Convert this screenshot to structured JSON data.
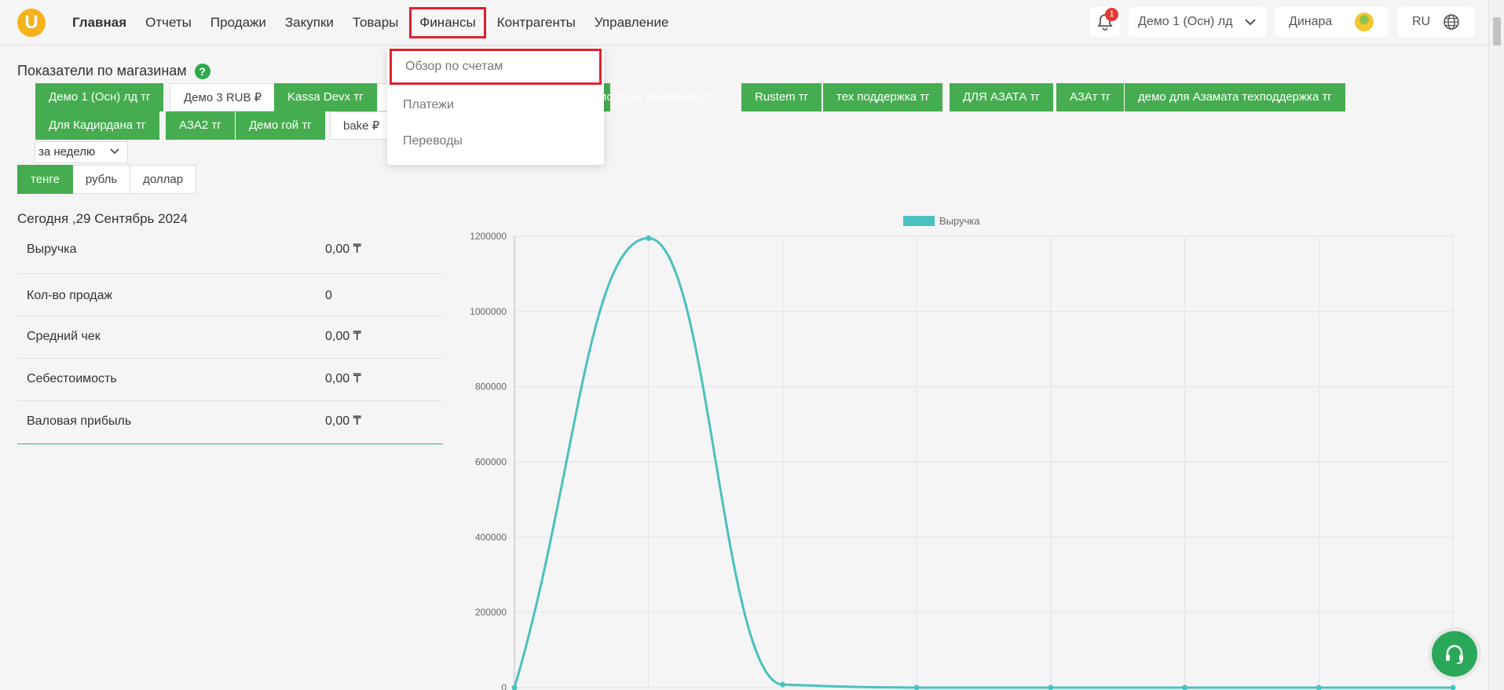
{
  "header": {
    "logo": "U",
    "nav": [
      "Главная",
      "Отчеты",
      "Продажи",
      "Закупки",
      "Товары",
      "Финансы",
      "Контрагенты",
      "Управление"
    ],
    "notifications": "1",
    "store": "Демо 1 (Осн) лд",
    "user": "Динара",
    "lang": "RU"
  },
  "dropdown": [
    "Обзор по счетам",
    "Платежи",
    "Переводы"
  ],
  "page": {
    "title": "Показатели по магазинам",
    "help": "?",
    "stores_row1": [
      "Демо 1 (Осн) лд тг",
      "Демо 3 RUB ₽",
      "Kassa Devx тг",
      "мо 3 (не основной) тг",
      "Rustem тг",
      "тех поддержка тг",
      "ДЛЯ АЗАТА тг",
      "АЗАт тг",
      "демо для Азамата техподдержка тг"
    ],
    "stores_row2": [
      "Для Кадирдана тг",
      "АЗА2 тг",
      "Демо гой тг",
      "bake ₽"
    ],
    "period": "за неделю",
    "currencies": [
      "тенге",
      "рубль",
      "доллар"
    ],
    "date": "Сегодня ,29 Сентябрь 2024",
    "metrics": [
      {
        "label": "Выручка",
        "value": "0,00 ₸"
      },
      {
        "label": "Кол-во продаж",
        "value": "0"
      },
      {
        "label": "Средний чек",
        "value": "0,00 ₸"
      },
      {
        "label": "Себестоимость",
        "value": "0,00 ₸"
      },
      {
        "label": "Валовая прибыль",
        "value": "0,00 ₸"
      }
    ]
  },
  "chart_data": {
    "type": "line",
    "series": [
      {
        "name": "Выручка",
        "values": [
          0,
          1195000,
          8000,
          0,
          0,
          0,
          0,
          0
        ]
      }
    ],
    "yticks": [
      "0",
      "200000",
      "400000",
      "600000",
      "800000",
      "1000000",
      "1200000"
    ],
    "ylim": [
      0,
      1200000
    ],
    "grid": true,
    "legend": "top",
    "color": "#4bc0c0"
  }
}
